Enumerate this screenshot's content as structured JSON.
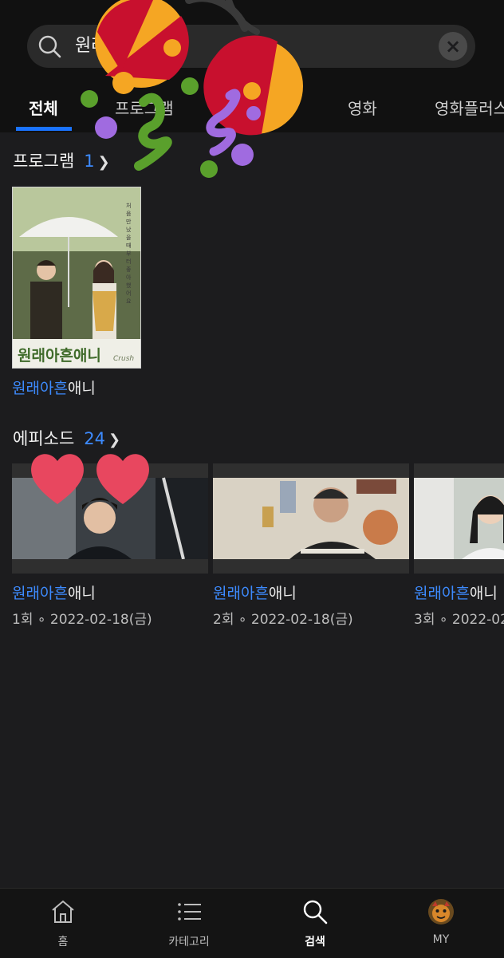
{
  "search": {
    "query": "원래아흔애니",
    "clear_label": "×"
  },
  "tabs": {
    "items": [
      {
        "label": "전체"
      },
      {
        "label": "프로그램"
      },
      {
        "label": "영화"
      },
      {
        "label": "영화플러스"
      }
    ],
    "active_index": 0
  },
  "programs": {
    "header": "프로그램",
    "count": "1",
    "items": [
      {
        "title_match": "원래아흔",
        "title_rest": "애니",
        "poster_title": "원래아흔애니",
        "poster_sub": "Crush",
        "poster_quote": "처음 만났을때부터 좋아했어요"
      }
    ]
  },
  "episodes": {
    "header": "에피소드",
    "count": "24",
    "items": [
      {
        "title_match": "원래아흔",
        "title_rest": "애니",
        "meta": "1회 ∘ 2022-02-18(금)"
      },
      {
        "title_match": "원래아흔",
        "title_rest": "애니",
        "meta": "2회 ∘ 2022-02-18(금)"
      },
      {
        "title_match": "원래아흔",
        "title_rest": "애니",
        "meta": "3회 ∘ 2022-02"
      }
    ]
  },
  "bottom_nav": {
    "items": [
      {
        "label": "홈",
        "icon": "home-icon"
      },
      {
        "label": "카테고리",
        "icon": "list-icon"
      },
      {
        "label": "검색",
        "icon": "search-icon"
      },
      {
        "label": "MY",
        "icon": "avatar"
      }
    ],
    "active_index": 2
  },
  "colors": {
    "accent": "#1a73ff",
    "highlight": "#3d8bff",
    "background": "#1c1c1e"
  }
}
